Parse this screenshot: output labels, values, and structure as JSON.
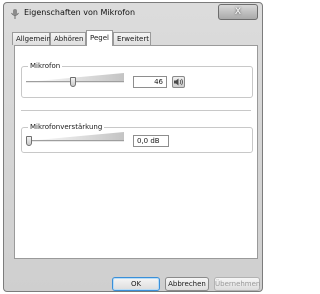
{
  "window": {
    "title": "Eigenschaften von Mikrofon",
    "close_label": "X"
  },
  "tabs": [
    {
      "label": "Allgemein",
      "active": false
    },
    {
      "label": "Abhören",
      "active": false
    },
    {
      "label": "Pegel",
      "active": true
    },
    {
      "label": "Erweitert",
      "active": false
    }
  ],
  "levels": {
    "mikrofon": {
      "label": "Mikrofon",
      "value": "46",
      "slider_fraction": 0.46,
      "speaker_icon": "speaker-icon"
    },
    "boost": {
      "label": "Mikrofonverstärkung",
      "value": "0,0 dB",
      "slider_fraction": 0.0
    }
  },
  "buttons": {
    "ok": "OK",
    "cancel": "Abbrechen",
    "apply": "Übernehmen"
  }
}
